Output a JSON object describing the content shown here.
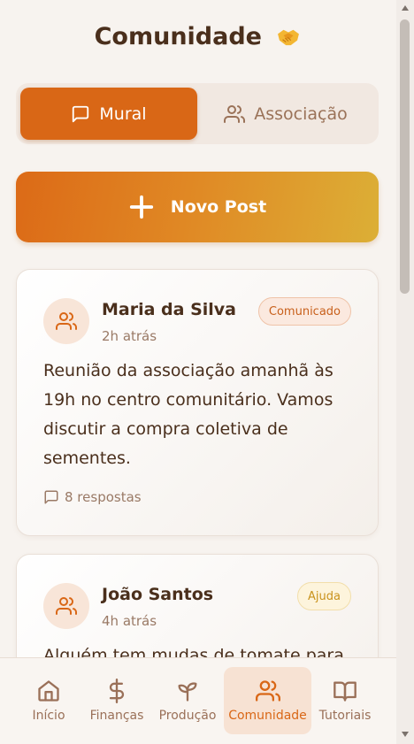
{
  "page": {
    "title": "Comunidade",
    "title_icon": "handshake-emoji"
  },
  "tabs": [
    {
      "label": "Mural",
      "icon": "chat-bubble-icon",
      "active": true
    },
    {
      "label": "Associação",
      "icon": "users-icon",
      "active": false
    }
  ],
  "new_post": {
    "label": "Novo Post",
    "icon": "plus-icon"
  },
  "posts": [
    {
      "author": "Maria da Silva",
      "time": "2h atrás",
      "badge": "Comunicado",
      "body": "Reunião da associação amanhã às 19h no centro comunitário. Vamos discutir a compra coletiva de sementes.",
      "replies": "8 respostas"
    },
    {
      "author": "João Santos",
      "time": "4h atrás",
      "badge": "Ajuda",
      "body": "Alguém tem mudas de tomate para"
    }
  ],
  "nav": [
    {
      "label": "Início",
      "icon": "home-icon",
      "active": false
    },
    {
      "label": "Finanças",
      "icon": "dollar-icon",
      "active": false
    },
    {
      "label": "Produção",
      "icon": "sprout-icon",
      "active": false
    },
    {
      "label": "Comunidade",
      "icon": "users-icon",
      "active": true
    },
    {
      "label": "Tutoriais",
      "icon": "book-icon",
      "active": false
    }
  ],
  "colors": {
    "primary": "#d96716",
    "gradient_end": "#dcaf36",
    "background": "#f7f3ef",
    "text_dark": "#4a2f1c"
  }
}
